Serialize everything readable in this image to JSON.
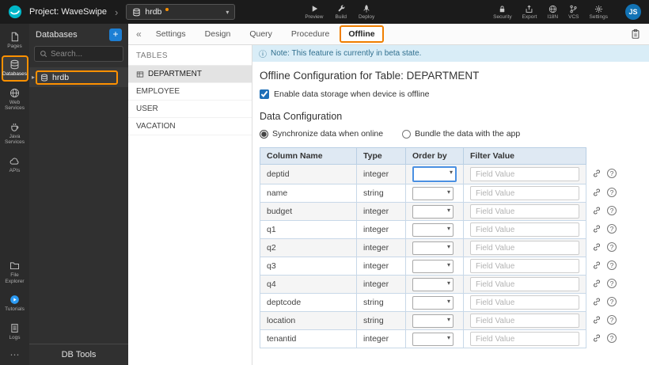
{
  "icons": {
    "plus": "+",
    "collapse": "«",
    "caret": "▾",
    "chevron": "›",
    "tree_caret": "▸",
    "info": "ⓘ",
    "ellipsis": "⋯",
    "help": "?"
  },
  "topbar": {
    "project_label": "Project: WaveSwipe",
    "db_selector": {
      "value": "hrdb"
    },
    "actions": [
      {
        "label": "Preview"
      },
      {
        "label": "Build"
      },
      {
        "label": "Deploy"
      }
    ],
    "utilities": [
      {
        "label": "Security"
      },
      {
        "label": "Export"
      },
      {
        "label": "I18N"
      },
      {
        "label": "VCS"
      },
      {
        "label": "Settings"
      }
    ],
    "avatar": "JS"
  },
  "sidebar": {
    "items": [
      {
        "label": "Pages",
        "state": ""
      },
      {
        "label": "Databases",
        "state": "active"
      },
      {
        "label": "Web Services",
        "state": ""
      },
      {
        "label": "Java Services",
        "state": ""
      },
      {
        "label": "APIs",
        "state": ""
      },
      {
        "label": "File Explorer",
        "state": ""
      },
      {
        "label": "Tutorials",
        "state": ""
      },
      {
        "label": "Logs",
        "state": ""
      }
    ]
  },
  "db_panel": {
    "title": "Databases",
    "search_placeholder": "Search...",
    "tree": [
      {
        "label": "hrdb",
        "state": "active"
      }
    ],
    "footer_label": "DB Tools"
  },
  "content": {
    "tabs": [
      {
        "label": "Settings",
        "state": ""
      },
      {
        "label": "Design",
        "state": ""
      },
      {
        "label": "Query",
        "state": ""
      },
      {
        "label": "Procedure",
        "state": ""
      },
      {
        "label": "Offline",
        "state": "active"
      }
    ],
    "tables_panel": {
      "title": "TABLES",
      "items": [
        {
          "label": "DEPARTMENT",
          "state": "active"
        },
        {
          "label": "EMPLOYEE",
          "state": ""
        },
        {
          "label": "USER",
          "state": ""
        },
        {
          "label": "VACATION",
          "state": ""
        }
      ]
    },
    "offline": {
      "note": "Note: This feature is currently in beta state.",
      "title": "Offline Configuration for Table: DEPARTMENT",
      "enable_label": "Enable data storage when device is offline",
      "section_title": "Data Configuration",
      "radios": [
        {
          "label": "Synchronize data when online",
          "state": "selected"
        },
        {
          "label": "Bundle the data with the app",
          "state": ""
        }
      ],
      "table": {
        "headers": [
          "Column Name",
          "Type",
          "Order by",
          "Filter Value"
        ],
        "filter_placeholder": "Field Value",
        "rows": [
          {
            "name": "deptid",
            "type": "integer",
            "state": "focused"
          },
          {
            "name": "name",
            "type": "string",
            "state": ""
          },
          {
            "name": "budget",
            "type": "integer",
            "state": ""
          },
          {
            "name": "q1",
            "type": "integer",
            "state": ""
          },
          {
            "name": "q2",
            "type": "integer",
            "state": ""
          },
          {
            "name": "q3",
            "type": "integer",
            "state": ""
          },
          {
            "name": "q4",
            "type": "integer",
            "state": ""
          },
          {
            "name": "deptcode",
            "type": "string",
            "state": ""
          },
          {
            "name": "location",
            "type": "string",
            "state": ""
          },
          {
            "name": "tenantid",
            "type": "integer",
            "state": ""
          }
        ]
      }
    }
  }
}
